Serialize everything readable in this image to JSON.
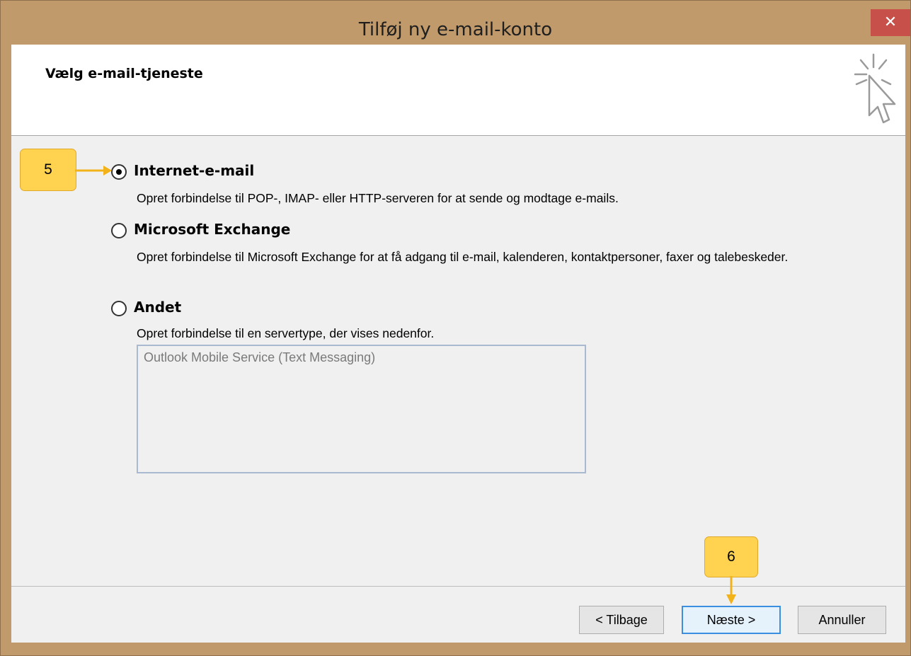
{
  "window": {
    "title": "Tilføj ny e-mail-konto",
    "close_icon": "close-icon",
    "close_glyph": "✕"
  },
  "header": {
    "title": "Vælg e-mail-tjeneste",
    "icon": "cursor-click-icon"
  },
  "options": [
    {
      "label": "Internet-e-mail",
      "description": "Opret forbindelse til POP-, IMAP- eller HTTP-serveren for at sende og modtage e-mails.",
      "selected": true
    },
    {
      "label": "Microsoft Exchange",
      "description": "Opret forbindelse til Microsoft Exchange for at få adgang til e-mail, kalenderen, kontaktpersoner, faxer og talebeskeder.",
      "selected": false
    },
    {
      "label": "Andet",
      "description": "Opret forbindelse til en servertype, der vises nedenfor.",
      "selected": false
    }
  ],
  "server_list": {
    "items": [
      "Outlook Mobile Service (Text Messaging)"
    ]
  },
  "buttons": {
    "back": "< Tilbage",
    "next": "Næste >",
    "cancel": "Annuller"
  },
  "annotations": {
    "step5": "5",
    "step6": "6"
  },
  "colors": {
    "titlebar": "#c19a6b",
    "close": "#c7504a",
    "callout": "#ffd34f",
    "default_button_border": "#3b8fe0"
  }
}
